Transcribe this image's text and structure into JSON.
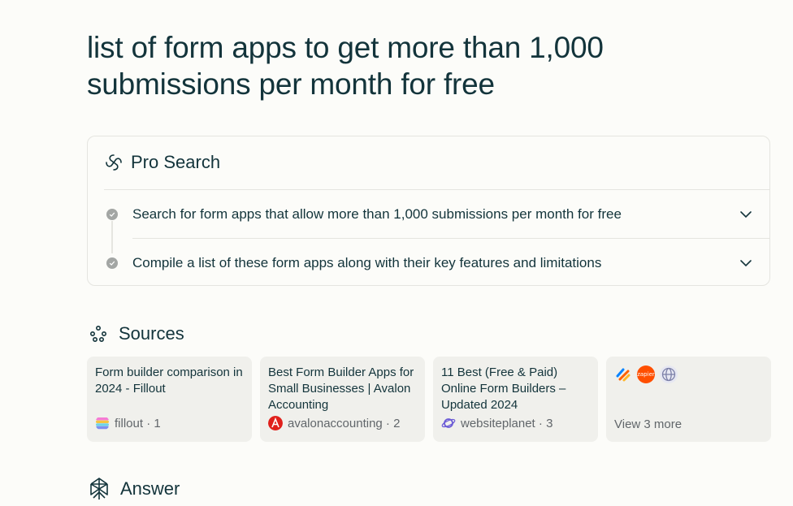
{
  "query": {
    "title": "list of form apps to get more than 1,000 submissions per month for free"
  },
  "pro_search": {
    "title": "Pro Search",
    "steps": [
      {
        "label": "Search for form apps that allow more than 1,000 submissions per month for free"
      },
      {
        "label": "Compile a list of these form apps along with their key features and limitations"
      }
    ]
  },
  "sources": {
    "heading": "Sources",
    "items": [
      {
        "title": "Form builder comparison in 2024 - Fillout",
        "site": "fillout",
        "index": "1",
        "favicon": "fillout-icon"
      },
      {
        "title": "Best Form Builder Apps for Small Businesses | Avalon Accounting",
        "site": "avalonaccounting",
        "index": "2",
        "favicon": "avalon-icon"
      },
      {
        "title": "11 Best (Free & Paid) Online Form Builders – Updated 2024",
        "site": "websiteplanet",
        "index": "3",
        "favicon": "websiteplanet-icon"
      }
    ],
    "more": {
      "label": "View 3 more",
      "icons": [
        "jotform-icon",
        "zapier-icon",
        "globe-icon"
      ],
      "zapier_text": "zapier"
    }
  },
  "answer": {
    "heading": "Answer"
  },
  "colors": {
    "text": "#13343b",
    "muted": "#61666a",
    "card_bg": "#f0f0ec",
    "page_bg": "#fcfcf9",
    "zapier": "#ff4f00",
    "avalon": "#e0201b"
  }
}
